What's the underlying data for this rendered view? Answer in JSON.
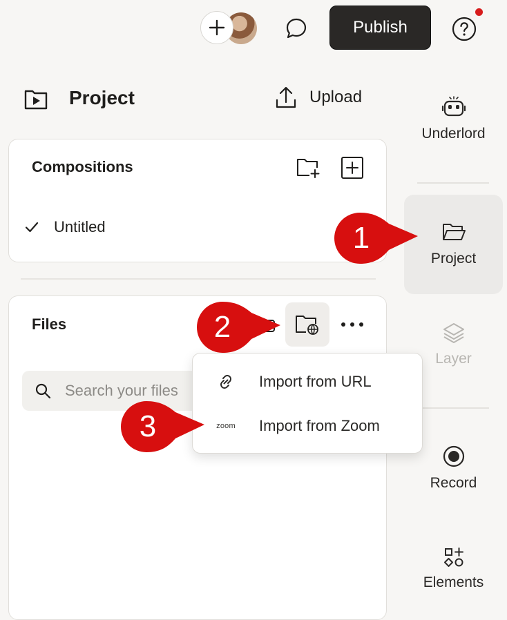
{
  "topbar": {
    "publish_label": "Publish"
  },
  "project": {
    "title": "Project",
    "upload_label": "Upload"
  },
  "compositions": {
    "title": "Compositions",
    "items": [
      {
        "label": "Untitled",
        "selected": true
      }
    ]
  },
  "files": {
    "title": "Files",
    "search_placeholder": "Search your files"
  },
  "import_menu": {
    "items": [
      {
        "label": "Import from URL",
        "icon": "link-icon"
      },
      {
        "label": "Import from Zoom",
        "icon": "zoom-logo",
        "logo_text": "zoom"
      }
    ]
  },
  "rail": {
    "items": [
      {
        "label": "Underlord",
        "icon": "robot-icon",
        "state": "normal"
      },
      {
        "label": "Project",
        "icon": "folder-open-icon",
        "state": "active"
      },
      {
        "label": "Layer",
        "icon": "layers-icon",
        "state": "disabled"
      },
      {
        "label": "Record",
        "icon": "record-icon",
        "state": "normal"
      },
      {
        "label": "Elements",
        "icon": "elements-icon",
        "state": "normal"
      }
    ]
  },
  "callouts": [
    {
      "number": "1",
      "target": "rail-project"
    },
    {
      "number": "2",
      "target": "import-from-web-button"
    },
    {
      "number": "3",
      "target": "import-from-zoom"
    }
  ],
  "colors": {
    "callout_red": "#d70f0f",
    "publish_bg": "#2a2826",
    "notification_dot": "#d71c1c"
  }
}
